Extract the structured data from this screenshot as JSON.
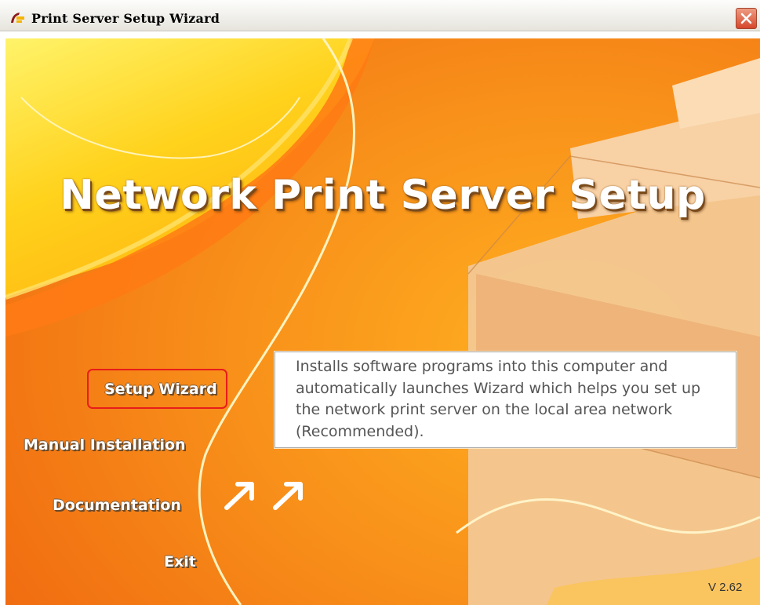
{
  "window": {
    "title": "Print Server Setup Wizard",
    "close_icon": "close-x-icon"
  },
  "main": {
    "headline": "Network Print Server Setup",
    "menu": [
      {
        "label": "Setup Wizard",
        "selected": true
      },
      {
        "label": "Manual Installation"
      },
      {
        "label": "Documentation"
      },
      {
        "label": "Exit"
      }
    ],
    "description": "Installs software programs into this computer and automatically launches Wizard which helps you set up the network print server on the local area network (Recommended).",
    "version": "V 2.62"
  },
  "colors": {
    "background": "#f59a12",
    "highlight_border": "#e81c1c",
    "close_button": "#d6462a"
  }
}
